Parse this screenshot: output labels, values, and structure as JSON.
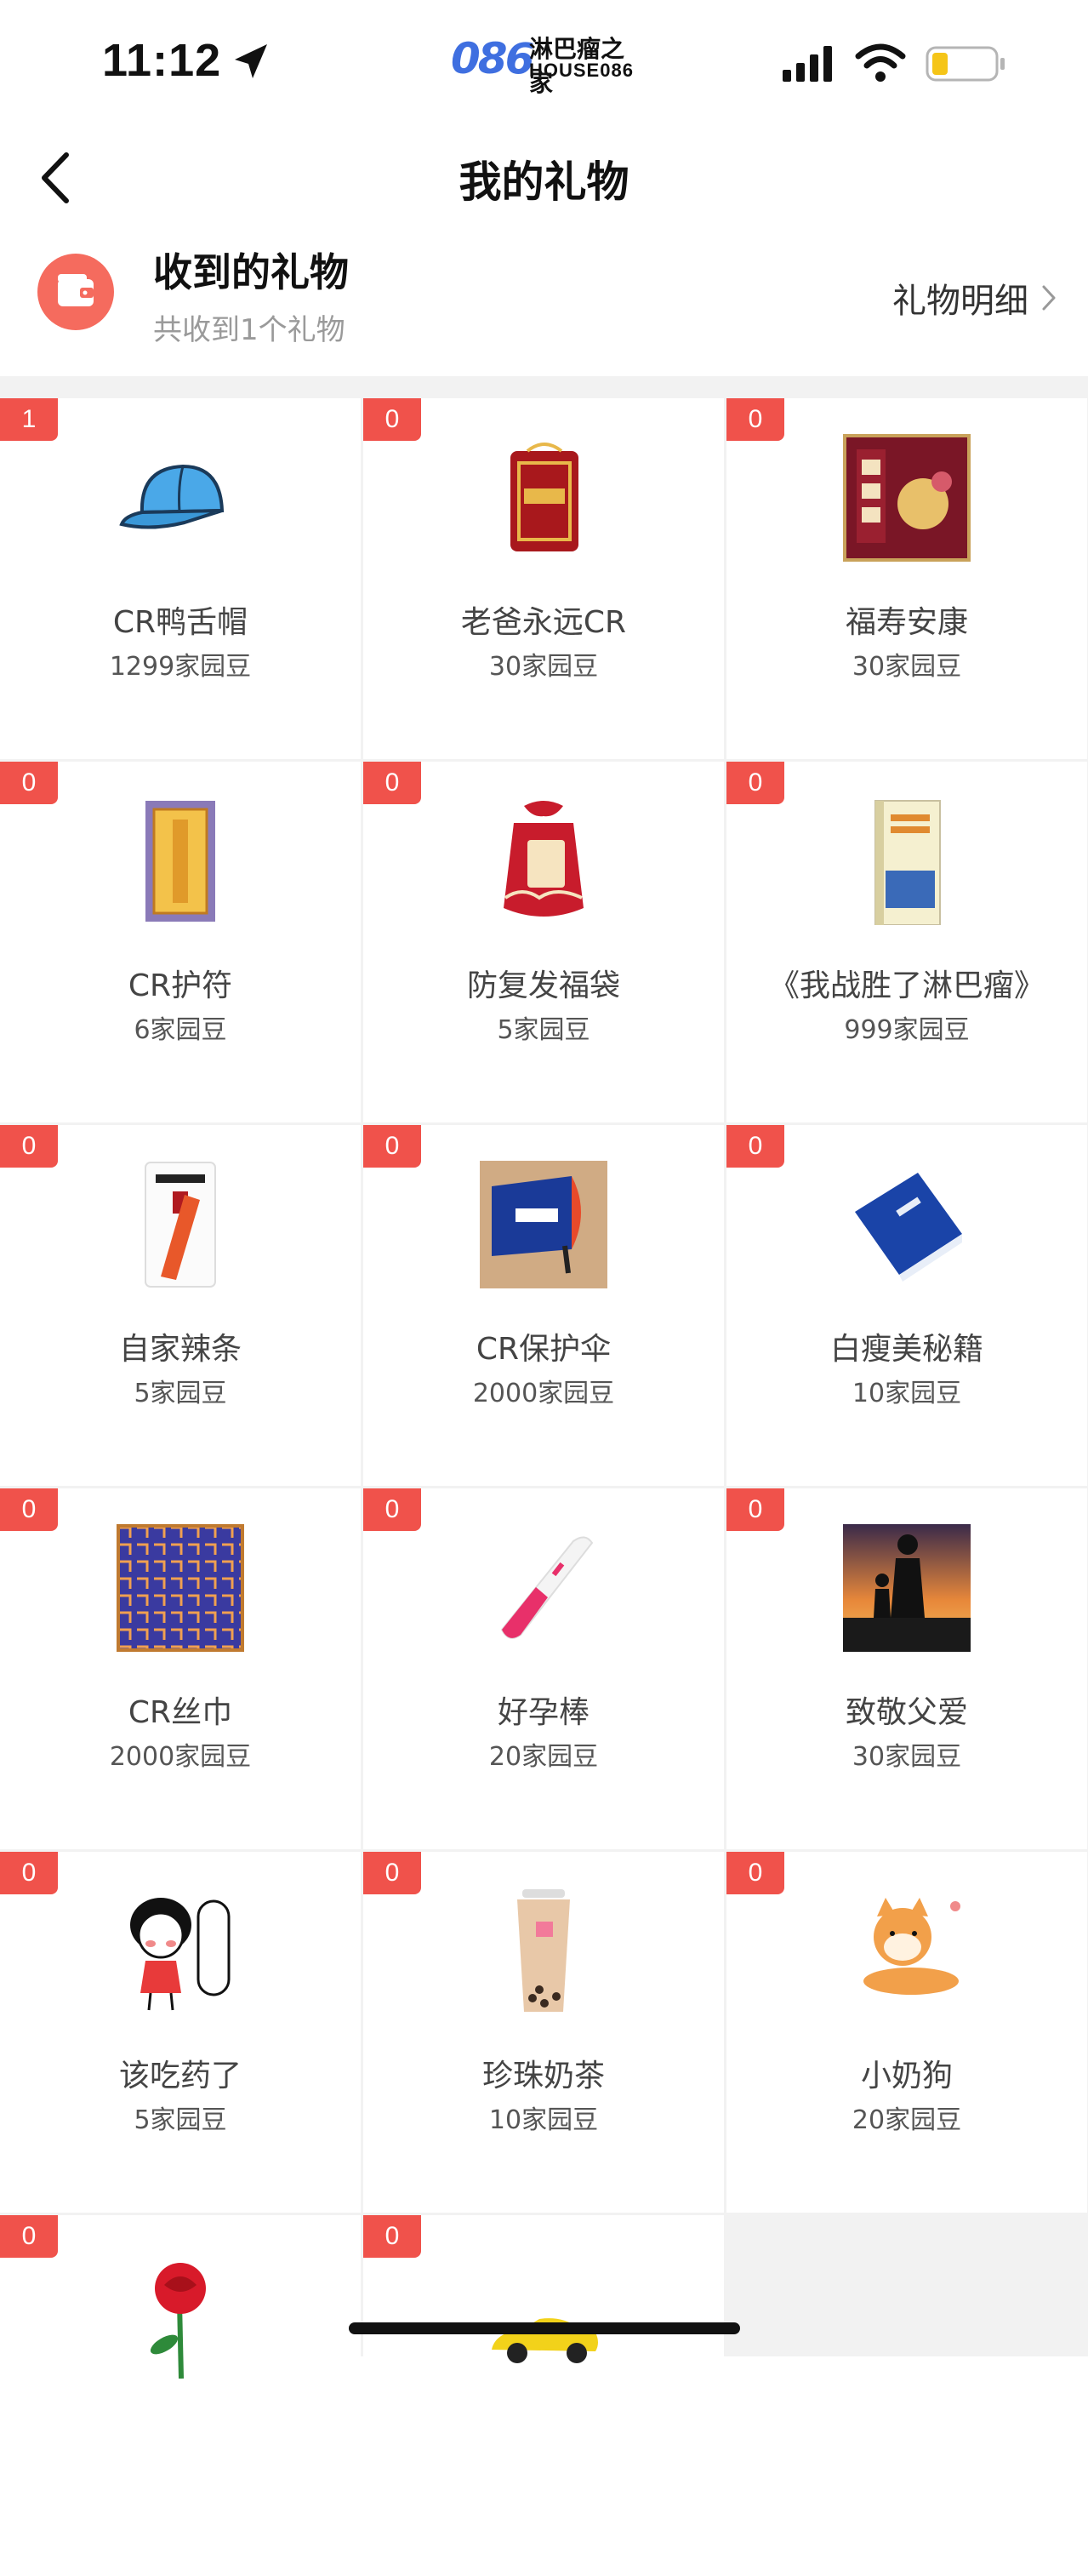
{
  "status_bar": {
    "time": "11:12",
    "logo_mark": "086",
    "logo_name": "淋巴瘤之家",
    "logo_sub": "HOUSE086",
    "icons": [
      "location-arrow-icon",
      "signal-icon",
      "wifi-icon",
      "battery-icon"
    ]
  },
  "nav": {
    "title": "我的礼物",
    "back_icon": "chevron-left-icon"
  },
  "summary": {
    "title": "收到的礼物",
    "subtitle": "共收到1个礼物",
    "detail_label": "礼物明细",
    "icon": "wallet-icon"
  },
  "colors": {
    "accent": "#f0524b",
    "wallet_bg": "#f56b5e",
    "grey_bg": "#f2f2f2"
  },
  "gifts": [
    {
      "count": "1",
      "name": "CR鸭舌帽",
      "price": "1299家园豆",
      "icon": "cap-icon"
    },
    {
      "count": "0",
      "name": "老爸永远CR",
      "price": "30家园豆",
      "icon": "amulet-icon"
    },
    {
      "count": "0",
      "name": "福寿安康",
      "price": "30家园豆",
      "icon": "peach-card-icon"
    },
    {
      "count": "0",
      "name": "CR护符",
      "price": "6家园豆",
      "icon": "talisman-icon"
    },
    {
      "count": "0",
      "name": "防复发福袋",
      "price": "5家园豆",
      "icon": "lucky-bag-icon"
    },
    {
      "count": "0",
      "name": "《我战胜了淋巴瘤》",
      "price": "999家园豆",
      "icon": "book-icon"
    },
    {
      "count": "0",
      "name": "自家辣条",
      "price": "5家园豆",
      "icon": "snack-icon"
    },
    {
      "count": "0",
      "name": "CR保护伞",
      "price": "2000家园豆",
      "icon": "umbrella-icon"
    },
    {
      "count": "0",
      "name": "白瘦美秘籍",
      "price": "10家园豆",
      "icon": "manual-icon"
    },
    {
      "count": "0",
      "name": "CR丝巾",
      "price": "2000家园豆",
      "icon": "scarf-icon"
    },
    {
      "count": "0",
      "name": "好孕棒",
      "price": "20家园豆",
      "icon": "test-stick-icon"
    },
    {
      "count": "0",
      "name": "致敬父爱",
      "price": "30家园豆",
      "icon": "father-icon"
    },
    {
      "count": "0",
      "name": "该吃药了",
      "price": "5家园豆",
      "icon": "cartoon-girl-icon"
    },
    {
      "count": "0",
      "name": "珍珠奶茶",
      "price": "10家园豆",
      "icon": "milk-tea-icon"
    },
    {
      "count": "0",
      "name": "小奶狗",
      "price": "20家园豆",
      "icon": "puppy-icon"
    },
    {
      "count": "0",
      "name": "",
      "price": "",
      "icon": "rose-icon"
    },
    {
      "count": "0",
      "name": "",
      "price": "",
      "icon": "sports-car-icon"
    }
  ]
}
